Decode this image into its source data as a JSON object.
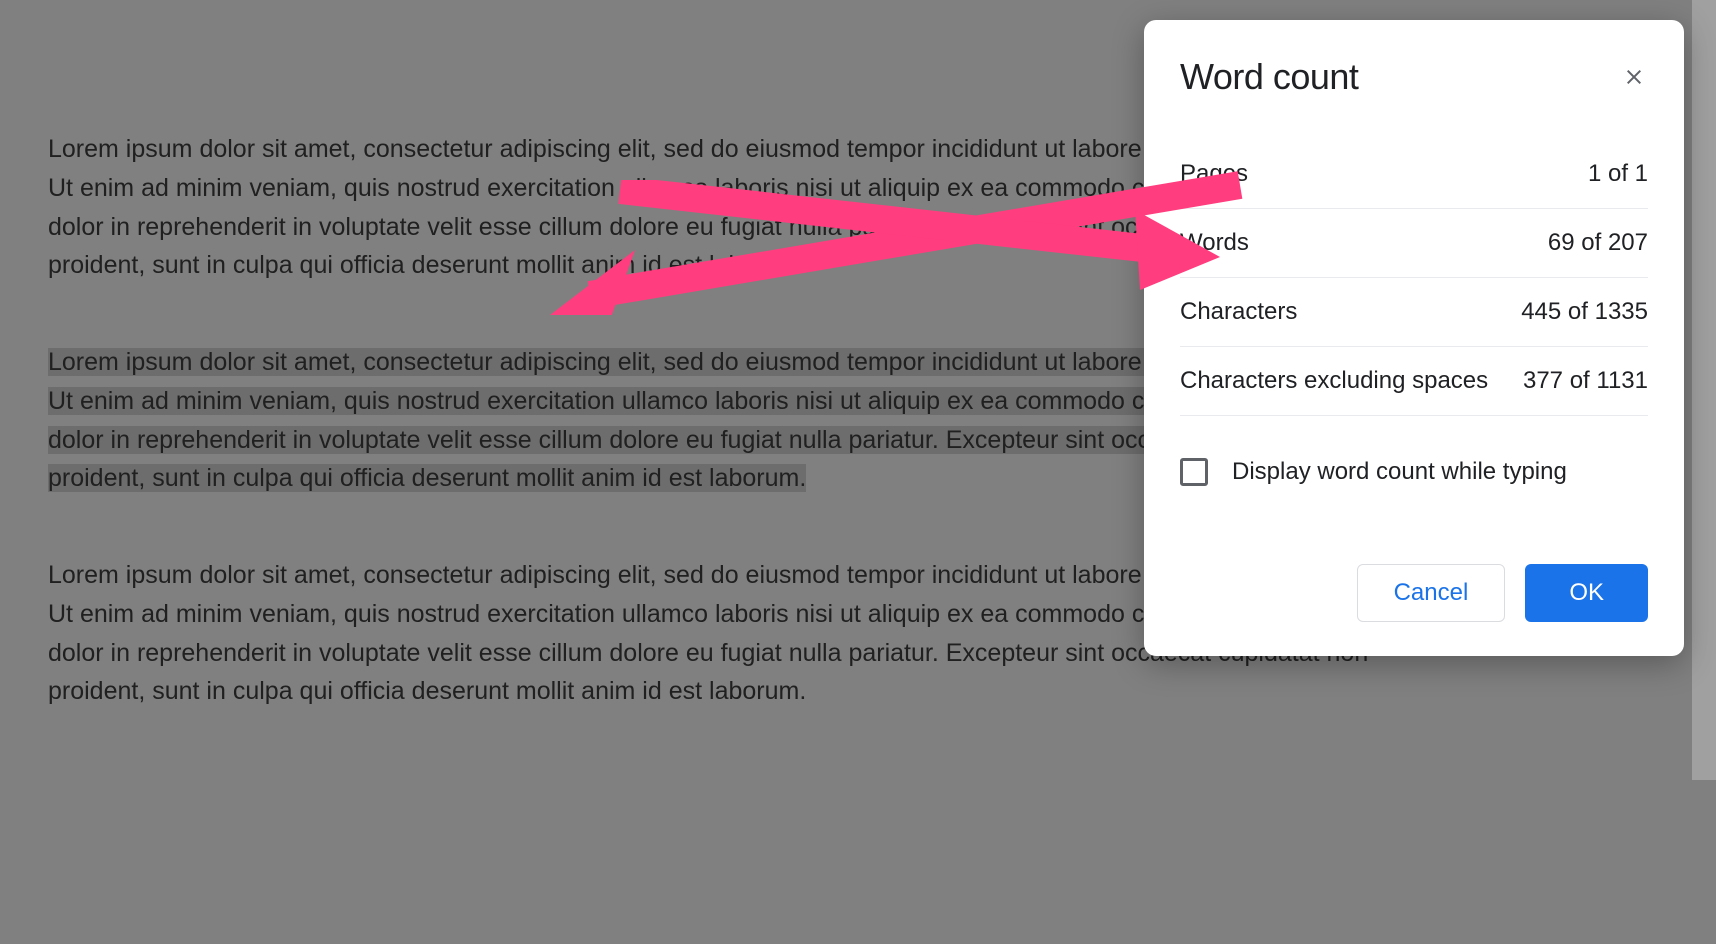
{
  "document": {
    "paragraphs": [
      "Lorem ipsum dolor sit amet, consectetur adipiscing elit, sed do eiusmod tempor incididunt ut labore et dolore magna aliqua. Ut enim ad minim veniam, quis nostrud exercitation ullamco laboris nisi ut aliquip ex ea commodo consequat. Duis aute irure dolor in reprehenderit in voluptate velit esse cillum dolore eu fugiat nulla pariatur. Excepteur sint occaecat cupidatat non proident, sunt in culpa qui officia deserunt mollit anim id est laborum.",
      "Lorem ipsum dolor sit amet, consectetur adipiscing elit, sed do eiusmod tempor incididunt ut labore et dolore magna aliqua. Ut enim ad minim veniam, quis nostrud exercitation ullamco laboris nisi ut aliquip ex ea commodo consequat. Duis aute irure dolor in reprehenderit in voluptate velit esse cillum dolore eu fugiat nulla pariatur. Excepteur sint occaecat cupidatat non proident, sunt in culpa qui officia deserunt mollit anim id est laborum.",
      "Lorem ipsum dolor sit amet, consectetur adipiscing elit, sed do eiusmod tempor incididunt ut labore et dolore magna aliqua. Ut enim ad minim veniam, quis nostrud exercitation ullamco laboris nisi ut aliquip ex ea commodo consequat. Duis aute irure dolor in reprehenderit in voluptate velit esse cillum dolore eu fugiat nulla pariatur. Excepteur sint occaecat cupidatat non proident, sunt in culpa qui officia deserunt mollit anim id est laborum."
    ]
  },
  "dialog": {
    "title": "Word count",
    "stats": [
      {
        "label": "Pages",
        "value": "1 of 1"
      },
      {
        "label": "Words",
        "value": "69 of 207"
      },
      {
        "label": "Characters",
        "value": "445 of 1335"
      },
      {
        "label": "Characters excluding spaces",
        "value": "377 of 1131"
      }
    ],
    "checkbox_label": "Display word count while typing",
    "cancel_label": "Cancel",
    "ok_label": "OK"
  }
}
